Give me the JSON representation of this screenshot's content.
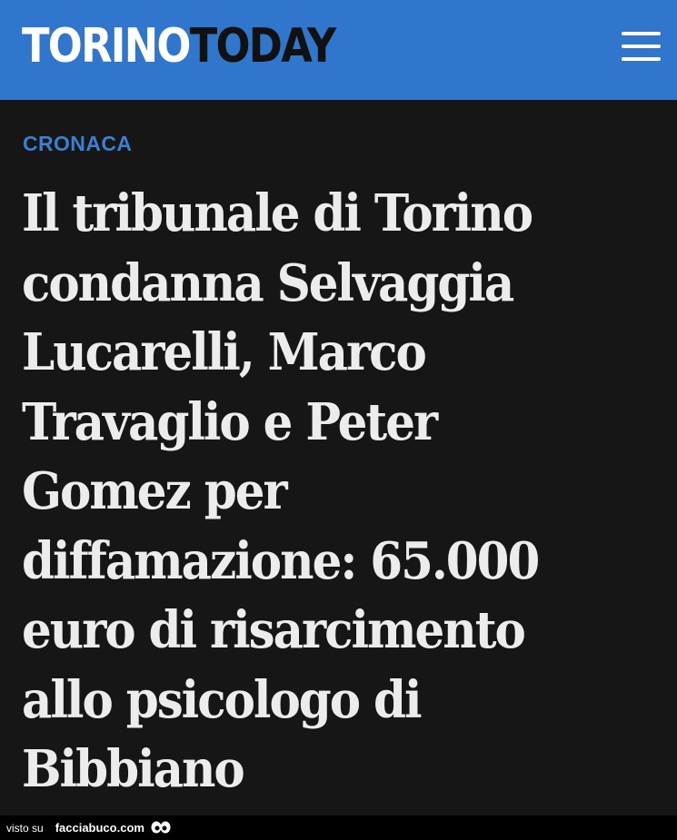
{
  "header": {
    "logo_part1": "TORINO",
    "logo_part2": "TODAY",
    "menu_icon": "hamburger-menu-icon",
    "background_color": "#2f76cc"
  },
  "article": {
    "category": "CRONACA",
    "headline_lines": [
      "Il tribunale di Torino",
      "condanna Selvaggia",
      "Lucarelli, Marco",
      "Travaglio e Peter",
      "Gomez per",
      "diffamazione: 65.000",
      "euro di risarcimento",
      "allo psicologo di",
      "Bibbiano"
    ]
  },
  "footer": {
    "visto_label": "visto su",
    "site_label": "facciabuco.com",
    "eyes_icon": "eyes-icon"
  }
}
